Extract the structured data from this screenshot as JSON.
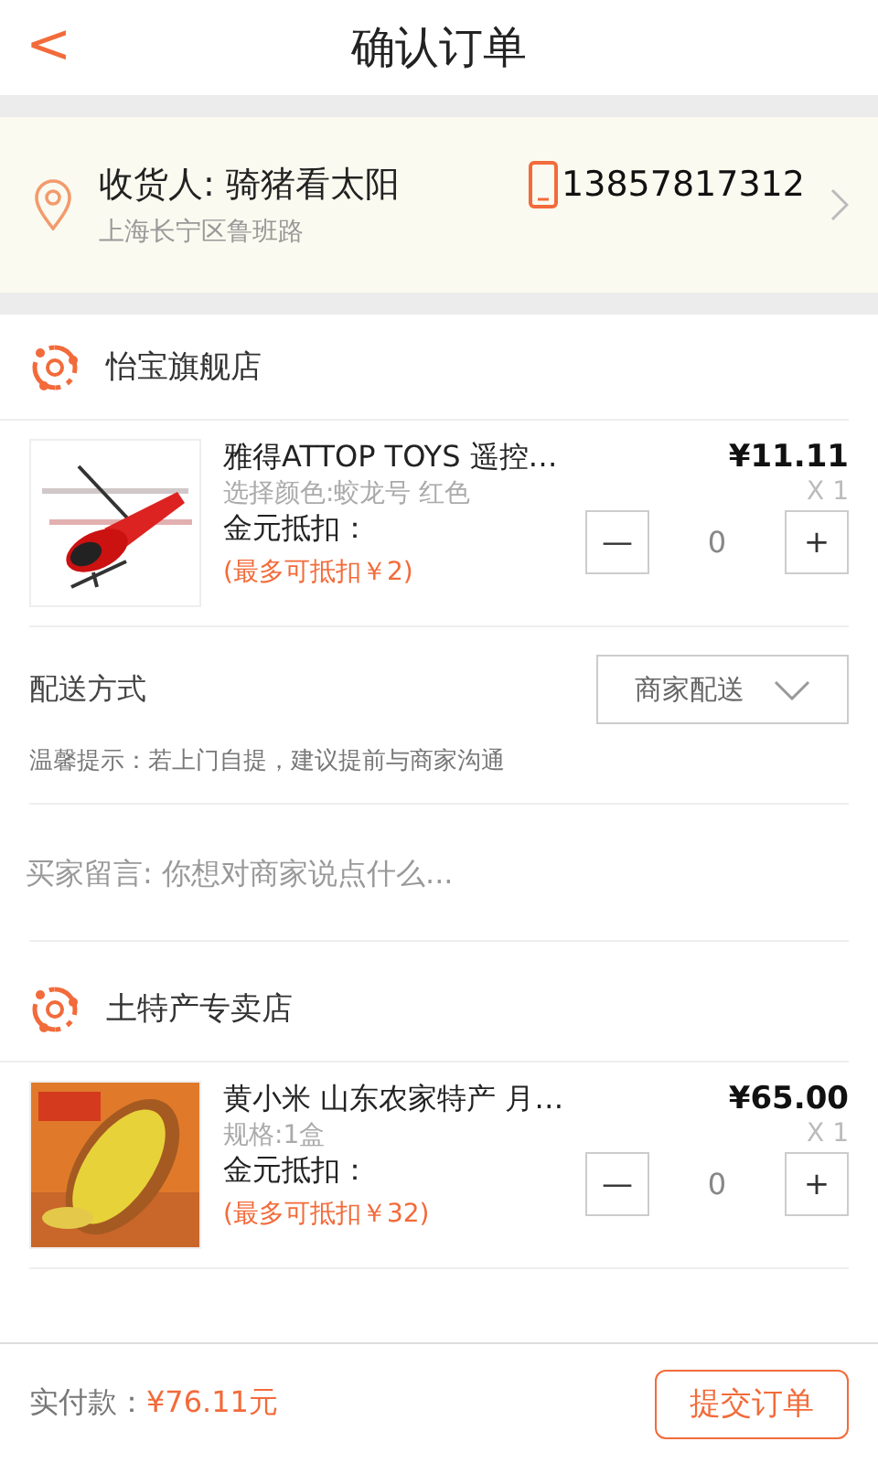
{
  "header": {
    "back": "<",
    "title": "确认订单"
  },
  "address": {
    "receiver": "收货人: 骑猪看太阳",
    "phone": "13857817312",
    "street": "上海长宁区鲁班路"
  },
  "stores": [
    {
      "name": "怡宝旗舰店",
      "product": {
        "title": "雅得ATTOP TOYS 遥控…",
        "spec": "选择颜色:蛟龙号 红色",
        "price": "¥11.11",
        "qty": "X 1",
        "coin_label": "金元抵扣：",
        "coin_max": "(最多可抵扣￥2)",
        "stepper": {
          "minus": "—",
          "value": "0",
          "plus": "+"
        }
      },
      "delivery": {
        "label": "配送方式",
        "option": "商家配送"
      },
      "hint": "温馨提示：若上门自提，建议提前与商家沟通",
      "message": {
        "placeholder": "买家留言: 你想对商家说点什么..."
      }
    },
    {
      "name": "土特产专卖店",
      "product": {
        "title": "黄小米 山东农家特产 月…",
        "spec": "规格:1盒",
        "price": "¥65.00",
        "qty": "X 1",
        "coin_label": "金元抵扣：",
        "coin_max": "(最多可抵扣￥32)",
        "stepper": {
          "minus": "—",
          "value": "0",
          "plus": "+"
        }
      }
    }
  ],
  "footer": {
    "total_label": "实付款：",
    "total": "¥76.11元",
    "submit": "提交订单"
  }
}
